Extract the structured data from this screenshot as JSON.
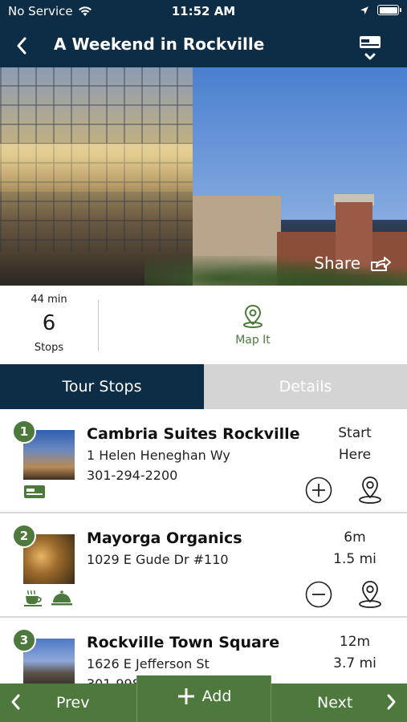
{
  "status_bar": {
    "carrier": "No Service",
    "time": "11:52 AM"
  },
  "nav": {
    "title": "A Weekend in Rockville"
  },
  "hero": {
    "share_label": "Share"
  },
  "stats": {
    "duration": "44 min",
    "stop_count": "6",
    "stop_label": "Stops",
    "map_label": "Map It"
  },
  "tabs": [
    {
      "label": "Tour Stops",
      "active": true
    },
    {
      "label": "Details",
      "active": false
    }
  ],
  "stops": [
    {
      "number": "1",
      "name": "Cambria Suites Rockville",
      "address": "1 Helen Heneghan Wy",
      "phone": "301-294-2200",
      "meta1": "Start",
      "meta2": "Here",
      "action": "add",
      "category_icons": [
        "ticket-icon"
      ]
    },
    {
      "number": "2",
      "name": "Mayorga Organics",
      "address": "1029 E Gude Dr #110",
      "phone": "",
      "meta1": "6m",
      "meta2": "1.5 mi",
      "action": "remove",
      "category_icons": [
        "coffee-cup-icon",
        "food-cloche-icon"
      ]
    },
    {
      "number": "3",
      "name": "Rockville Town Square",
      "address": "1626 E Jefferson St",
      "phone": "301-998",
      "meta1": "12m",
      "meta2": "3.7 mi",
      "action": "remove",
      "category_icons": []
    }
  ],
  "bottom_bar": {
    "prev_label": "Prev",
    "add_label": "Add",
    "next_label": "Next"
  },
  "colors": {
    "navy": "#0d2c45",
    "green": "#4d7a3c",
    "tab_inactive": "#d4d4d4"
  }
}
